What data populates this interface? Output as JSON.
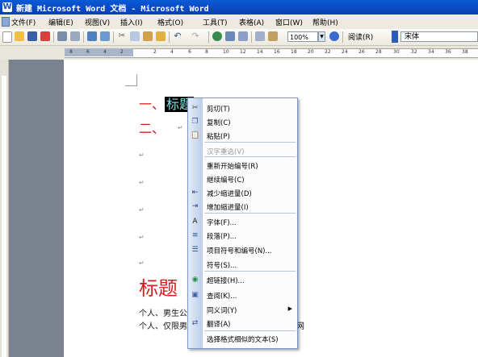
{
  "window": {
    "title": "新建 Microsoft Word 文档 - Microsoft Word"
  },
  "menubar": {
    "items": [
      {
        "label": "文件(F)"
      },
      {
        "label": "编辑(E)"
      },
      {
        "label": "视图(V)"
      },
      {
        "label": "插入(I)"
      },
      {
        "label": "格式(O)"
      },
      {
        "label": "工具(T)"
      },
      {
        "label": "表格(A)"
      },
      {
        "label": "窗口(W)"
      },
      {
        "label": "帮助(H)"
      }
    ]
  },
  "toolbar": {
    "zoom": "100%",
    "read_label": "阅读(R)",
    "font_name": "宋体"
  },
  "ruler": {
    "ticks": [
      "8",
      "6",
      "4",
      "2",
      "2",
      "4",
      "6",
      "8",
      "10",
      "12",
      "14",
      "16",
      "18",
      "20",
      "22",
      "24",
      "26",
      "28",
      "30",
      "32",
      "34",
      "36",
      "38"
    ]
  },
  "document": {
    "heading1_num": "一、",
    "heading1_selected": "标题",
    "heading2_num": "二、",
    "big_heading": "标题",
    "body_line1": "个人、男生公",
    "body_line2": "个人、仅限男",
    "body_line2_tail": "网"
  },
  "context_menu": {
    "items": [
      {
        "label": "剪切(T)",
        "icon": "scissors-icon"
      },
      {
        "label": "复制(C)",
        "icon": "copy-icon"
      },
      {
        "label": "粘贴(P)",
        "icon": "paste-icon"
      },
      {
        "label": "汉字重选(V)",
        "icon": "",
        "disabled": true
      },
      {
        "label": "重新开始编号(R)",
        "icon": ""
      },
      {
        "label": "继续编号(C)",
        "icon": ""
      },
      {
        "label": "减少缩进量(D)",
        "icon": "decrease-indent-icon"
      },
      {
        "label": "增加缩进量(I)",
        "icon": "increase-indent-icon"
      },
      {
        "label": "字体(F)...",
        "icon": "font-icon"
      },
      {
        "label": "段落(P)...",
        "icon": "paragraph-icon"
      },
      {
        "label": "项目符号和编号(N)...",
        "icon": "bullets-icon"
      },
      {
        "label": "符号(S)...",
        "icon": ""
      },
      {
        "label": "超链接(H)...",
        "icon": "hyperlink-icon"
      },
      {
        "label": "查阅(K)...",
        "icon": "lookup-icon"
      },
      {
        "label": "同义词(Y)",
        "icon": ""
      },
      {
        "label": "翻译(A)",
        "icon": "translate-icon"
      },
      {
        "label": "选择格式相似的文本(S)",
        "icon": ""
      }
    ]
  }
}
